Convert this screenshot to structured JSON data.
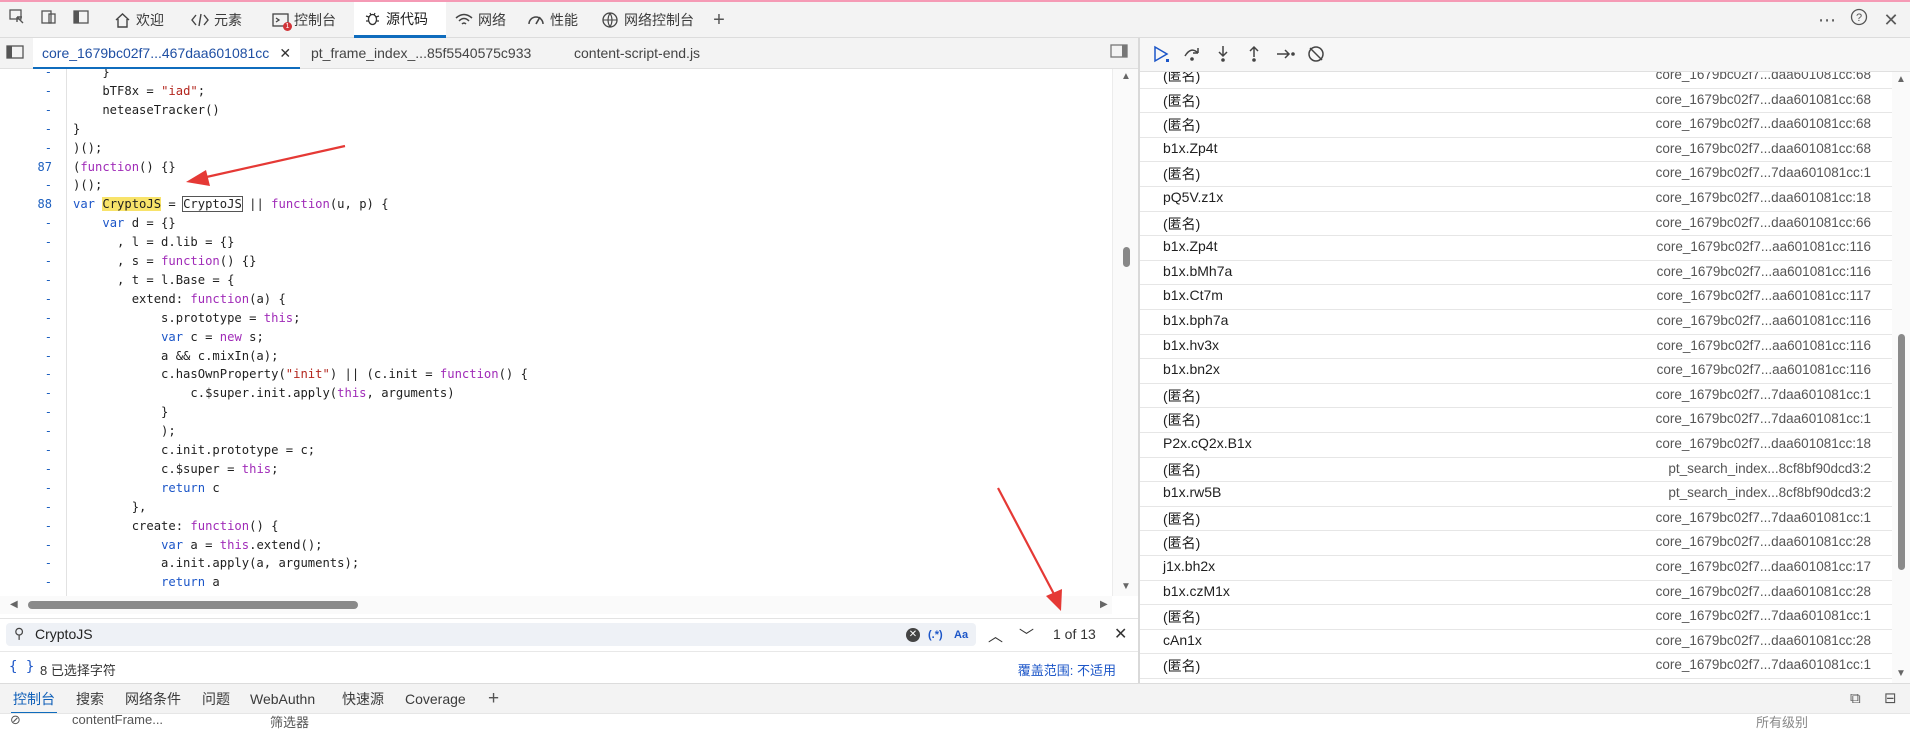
{
  "toolbar_tabs": [
    {
      "label": "欢迎",
      "icon": "home-icon"
    },
    {
      "label": "元素",
      "icon": "code-brackets-icon"
    },
    {
      "label": "控制台",
      "icon": "console-icon"
    },
    {
      "label": "源代码",
      "icon": "bug-icon"
    },
    {
      "label": "网络",
      "icon": "wifi-icon"
    },
    {
      "label": "性能",
      "icon": "gauge-icon"
    },
    {
      "label": "网络控制台",
      "icon": "network-console-icon"
    }
  ],
  "console_badge": "1",
  "file_tabs": [
    {
      "label": "core_1679bc02f7...467daa601081cc"
    },
    {
      "label": "pt_frame_index_...85f5540575c933"
    },
    {
      "label": "content-script-end.js"
    }
  ],
  "code_lines": [
    {
      "num": "-",
      "text": "    }"
    },
    {
      "num": "-",
      "text": "    bTF8x = \"iad\";"
    },
    {
      "num": "-",
      "text": "    neteaseTracker()"
    },
    {
      "num": "-",
      "text": "}"
    },
    {
      "num": "-",
      "text": ")();"
    },
    {
      "num": "87",
      "text": "(function() {}"
    },
    {
      "num": "-",
      "text": ")();"
    },
    {
      "num": "88",
      "text": "var CryptoJS = CryptoJS || function(u, p) {"
    },
    {
      "num": "-",
      "text": "    var d = {}"
    },
    {
      "num": "-",
      "text": "      , l = d.lib = {}"
    },
    {
      "num": "-",
      "text": "      , s = function() {}"
    },
    {
      "num": "-",
      "text": "      , t = l.Base = {"
    },
    {
      "num": "-",
      "text": "        extend: function(a) {"
    },
    {
      "num": "-",
      "text": "            s.prototype = this;"
    },
    {
      "num": "-",
      "text": "            var c = new s;"
    },
    {
      "num": "-",
      "text": "            a && c.mixIn(a);"
    },
    {
      "num": "-",
      "text": "            c.hasOwnProperty(\"init\") || (c.init = function() {"
    },
    {
      "num": "-",
      "text": "                c.$super.init.apply(this, arguments)"
    },
    {
      "num": "-",
      "text": "            }"
    },
    {
      "num": "-",
      "text": "            );"
    },
    {
      "num": "-",
      "text": "            c.init.prototype = c;"
    },
    {
      "num": "-",
      "text": "            c.$super = this;"
    },
    {
      "num": "-",
      "text": "            return c"
    },
    {
      "num": "-",
      "text": "        },"
    },
    {
      "num": "-",
      "text": "        create: function() {"
    },
    {
      "num": "-",
      "text": "            var a = this.extend();"
    },
    {
      "num": "-",
      "text": "            a.init.apply(a, arguments);"
    },
    {
      "num": "-",
      "text": "            return a"
    }
  ],
  "search": {
    "value": "CryptoJS",
    "regex_label": "(.*)",
    "case_label": "Aa",
    "matches": "1 of 13"
  },
  "status": {
    "braces": "{ }",
    "selected": "8 已选择字符",
    "coverage": "覆盖范围: 不适用"
  },
  "call_stack": [
    {
      "fn": "(匿名)",
      "loc": "core_1679bc02f7...daa601081cc:68"
    },
    {
      "fn": "(匿名)",
      "loc": "core_1679bc02f7...daa601081cc:68"
    },
    {
      "fn": "(匿名)",
      "loc": "core_1679bc02f7...daa601081cc:68"
    },
    {
      "fn": "b1x.Zp4t",
      "loc": "core_1679bc02f7...daa601081cc:68"
    },
    {
      "fn": "(匿名)",
      "loc": "core_1679bc02f7...7daa601081cc:1"
    },
    {
      "fn": "pQ5V.z1x",
      "loc": "core_1679bc02f7...daa601081cc:18"
    },
    {
      "fn": "(匿名)",
      "loc": "core_1679bc02f7...daa601081cc:66"
    },
    {
      "fn": "b1x.Zp4t",
      "loc": "core_1679bc02f7...aa601081cc:116"
    },
    {
      "fn": "b1x.bMh7a",
      "loc": "core_1679bc02f7...aa601081cc:116"
    },
    {
      "fn": "b1x.Ct7m",
      "loc": "core_1679bc02f7...aa601081cc:117"
    },
    {
      "fn": "b1x.bph7a",
      "loc": "core_1679bc02f7...aa601081cc:116"
    },
    {
      "fn": "b1x.hv3x",
      "loc": "core_1679bc02f7...aa601081cc:116"
    },
    {
      "fn": "b1x.bn2x",
      "loc": "core_1679bc02f7...aa601081cc:116"
    },
    {
      "fn": "(匿名)",
      "loc": "core_1679bc02f7...7daa601081cc:1"
    },
    {
      "fn": "(匿名)",
      "loc": "core_1679bc02f7...7daa601081cc:1"
    },
    {
      "fn": "P2x.cQ2x.B1x",
      "loc": "core_1679bc02f7...daa601081cc:18"
    },
    {
      "fn": "(匿名)",
      "loc": "pt_search_index...8cf8bf90dcd3:2"
    },
    {
      "fn": "b1x.rw5B",
      "loc": "pt_search_index...8cf8bf90dcd3:2"
    },
    {
      "fn": "(匿名)",
      "loc": "core_1679bc02f7...7daa601081cc:1"
    },
    {
      "fn": "(匿名)",
      "loc": "core_1679bc02f7...daa601081cc:28"
    },
    {
      "fn": "j1x.bh2x",
      "loc": "core_1679bc02f7...daa601081cc:17"
    },
    {
      "fn": "b1x.czM1x",
      "loc": "core_1679bc02f7...daa601081cc:28"
    },
    {
      "fn": "(匿名)",
      "loc": "core_1679bc02f7...7daa601081cc:1"
    },
    {
      "fn": "cAn1x",
      "loc": "core_1679bc02f7...daa601081cc:28"
    },
    {
      "fn": "(匿名)",
      "loc": "core_1679bc02f7...7daa601081cc:1"
    }
  ],
  "drawer_tabs": [
    {
      "label": "控制台"
    },
    {
      "label": "搜索"
    },
    {
      "label": "网络条件"
    },
    {
      "label": "问题"
    },
    {
      "label": "WebAuthn"
    },
    {
      "label": "快速源"
    },
    {
      "label": "Coverage"
    }
  ],
  "console_strip": {
    "context": "contentFrame...",
    "filter": "筛选器",
    "levels": "所有级别"
  },
  "colors": {
    "accent": "#0f6cbd",
    "highlight": "#f8e36a",
    "annotation_arrow": "#e53935"
  }
}
